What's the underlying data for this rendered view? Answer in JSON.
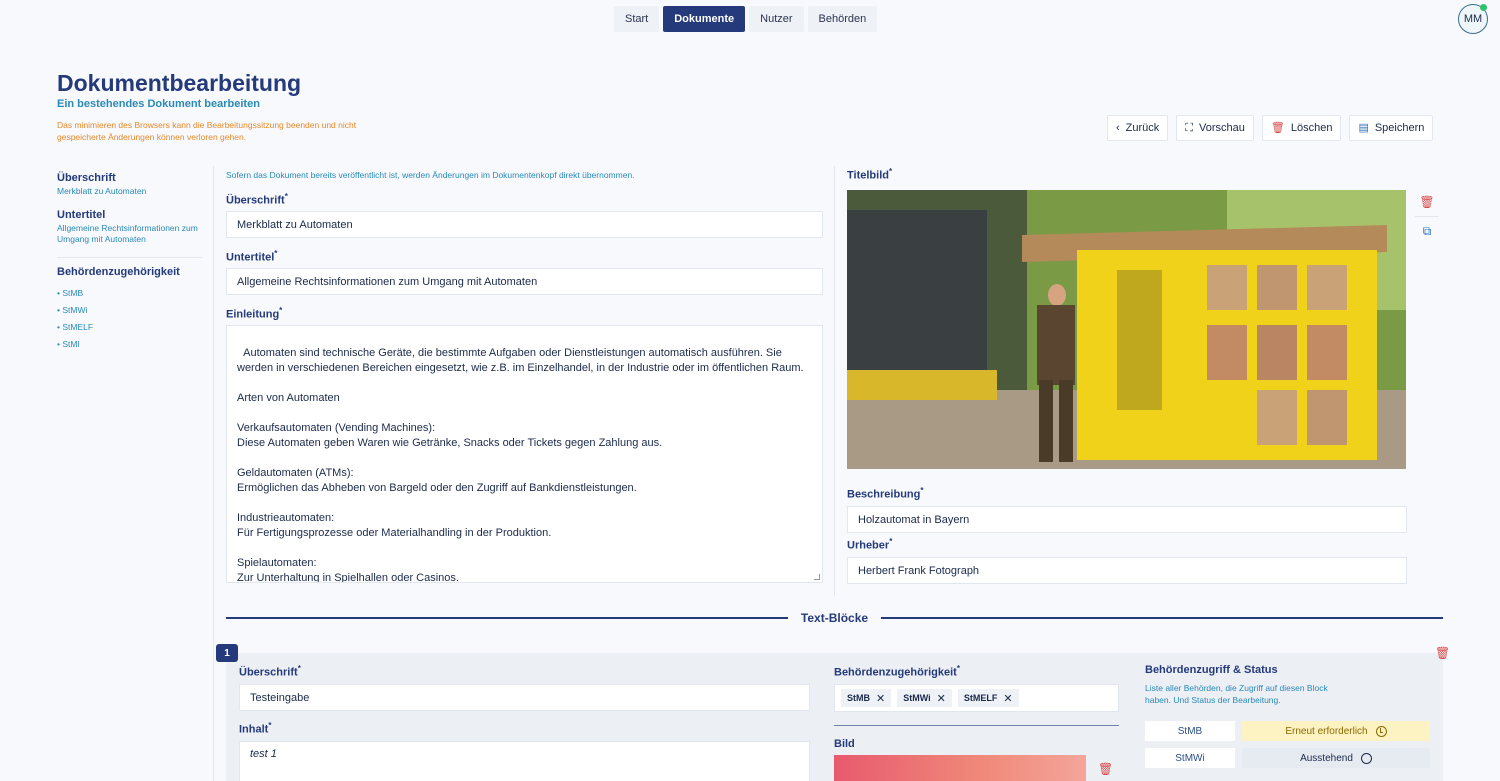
{
  "nav": {
    "tabs": [
      "Start",
      "Dokumente",
      "Nutzer",
      "Behörden"
    ],
    "active": "Dokumente"
  },
  "user": {
    "initials": "MM"
  },
  "header": {
    "title": "Dokumentbearbeitung",
    "subtitle": "Ein bestehendes Dokument bearbeiten",
    "warning": "Das minimieren des Browsers kann die Bearbeitungssitzung beenden und nicht gespeicherte Änderungen können verloren gehen."
  },
  "actions": {
    "back": "Zurück",
    "preview": "Vorschau",
    "delete": "Löschen",
    "save": "Speichern"
  },
  "sidebar": {
    "heading_label": "Überschrift",
    "heading_value": "Merkblatt zu Automaten",
    "subtitle_label": "Untertitel",
    "subtitle_value": "Allgemeine Rechtsinformationen zum Umgang mit Automaten",
    "authority_label": "Behördenzugehörigkeit",
    "authorities": [
      "StMB",
      "StMWi",
      "StMELF",
      "StMI"
    ]
  },
  "form": {
    "note": "Sofern das Dokument bereits veröffentlicht ist, werden Änderungen im Dokumentenkopf direkt übernommen.",
    "heading_label": "Überschrift",
    "heading_value": "Merkblatt zu Automaten",
    "subtitle_label": "Untertitel",
    "subtitle_value": "Allgemeine Rechtsinformationen zum Umgang mit Automaten",
    "intro_label": "Einleitung",
    "intro_value": "Automaten sind technische Geräte, die bestimmte Aufgaben oder Dienstleistungen automatisch ausführen. Sie werden in verschiedenen Bereichen eingesetzt, wie z.B. im Einzelhandel, in der Industrie oder im öffentlichen Raum.\n\nArten von Automaten\n\nVerkaufsautomaten (Vending Machines):\nDiese Automaten geben Waren wie Getränke, Snacks oder Tickets gegen Zahlung aus.\n\nGeldautomaten (ATMs):\nErmöglichen das Abheben von Bargeld oder den Zugriff auf Bankdienstleistungen.\n\nIndustrieautomaten:\nFür Fertigungsprozesse oder Materialhandling in der Produktion.\n\nSpielautomaten:\nZur Unterhaltung in Spielhallen oder Casinos.",
    "image_label": "Titelbild",
    "desc_label": "Beschreibung",
    "desc_value": "Holzautomat in Bayern",
    "author_label": "Urheber",
    "author_value": "Herbert Frank Fotograph"
  },
  "blocks_title": "Text-Blöcke",
  "block": {
    "number": "1",
    "heading_label": "Überschrift",
    "heading_value": "Testeingabe",
    "content_label": "Inhalt",
    "content_value": "test 1",
    "authority_label": "Behördenzugehörigkeit",
    "chips": [
      "StMB",
      "StMWi",
      "StMELF"
    ],
    "image_label": "Bild",
    "access_title": "Behördenzugriff & Status",
    "access_desc": "Liste aller Behörden, die Zugriff auf diesen Block haben. Und Status der Bearbeitung.",
    "access": [
      {
        "name": "StMB",
        "status": "Erneut erforderlich"
      },
      {
        "name": "StMWi",
        "status": "Ausstehend"
      }
    ]
  },
  "colors": {
    "primary": "#243a7a",
    "accent": "#2a8ab8",
    "warning": "#e8892a",
    "danger": "#d84a4a"
  }
}
